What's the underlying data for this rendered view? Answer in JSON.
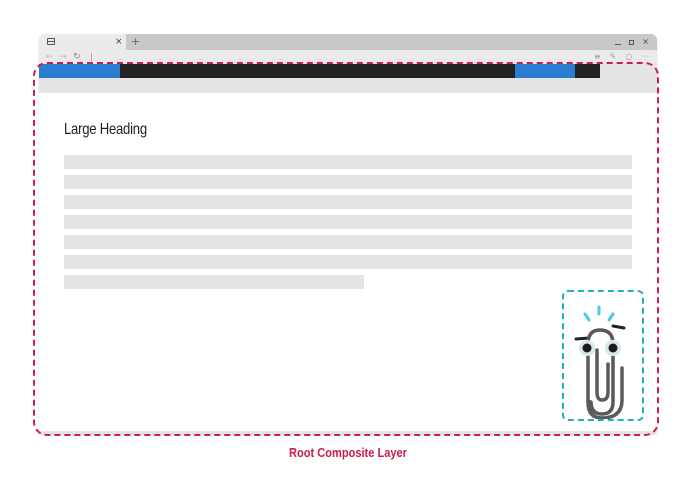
{
  "browser": {
    "tab": {
      "icon": "tab-page-icon",
      "close_glyph": "×"
    },
    "new_tab_glyph": "+",
    "window_controls": {
      "minimize": "minimize-icon",
      "maximize": "maximize-icon",
      "close_glyph": "×"
    },
    "toolbar": {
      "back_glyph": "←",
      "forward_glyph": "→",
      "reload_glyph": "↻",
      "menu_glyph": "≡",
      "edit_glyph": "✎",
      "account_glyph": "○",
      "more_glyph": "···"
    }
  },
  "page": {
    "heading": "Large Heading",
    "colors": {
      "top_bar": "#222222",
      "top_bar_accent": "#2a7dd0",
      "placeholder_line": "#e4e4e4"
    },
    "placeholder_lines": 7
  },
  "annotations": {
    "root_layer_label": "Root Composite Layer",
    "root_layer_color": "#cc1d4c",
    "child_layer_color": "#1fb0c8"
  },
  "assistant_character": {
    "name": "paperclip-assistant-icon"
  }
}
